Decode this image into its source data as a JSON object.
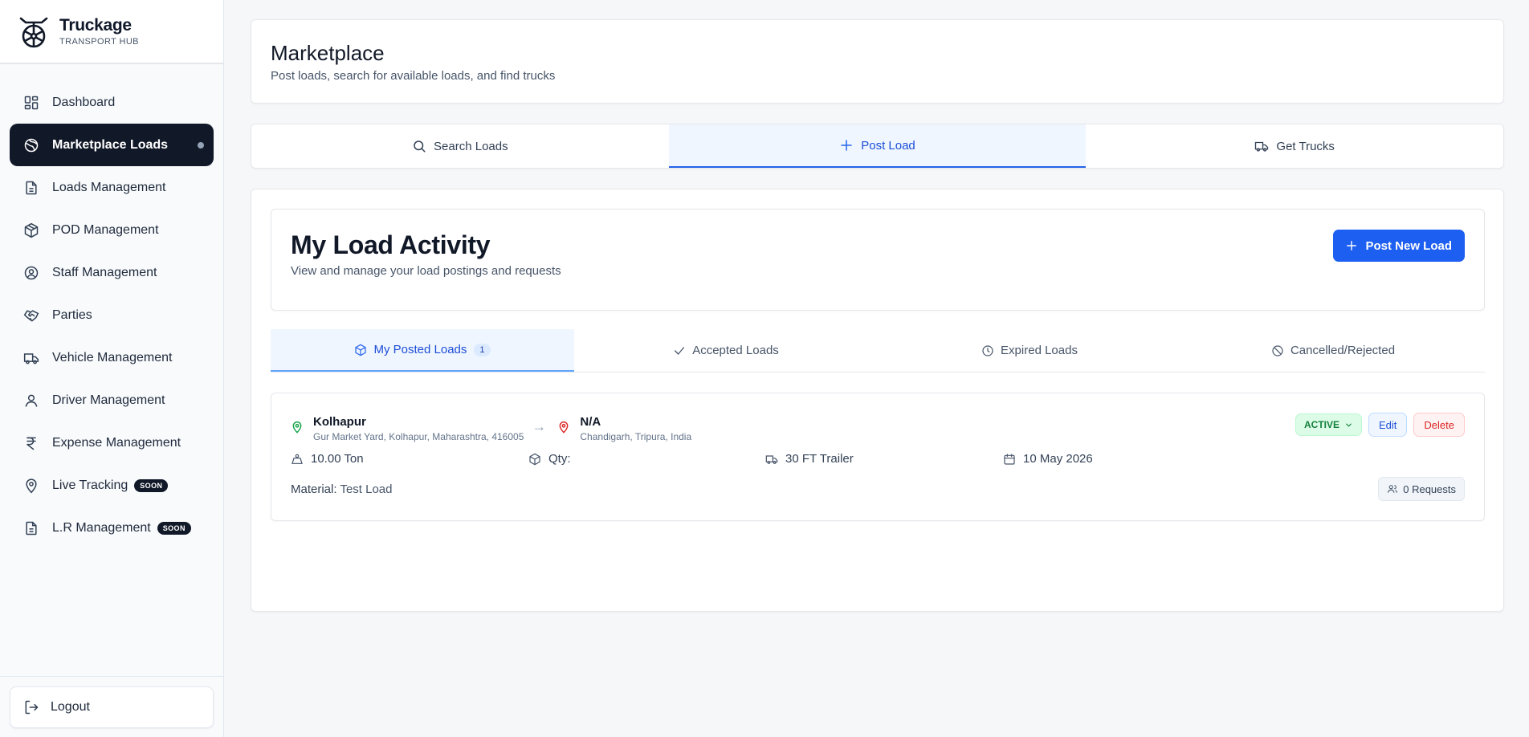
{
  "brand": {
    "name": "Truckage",
    "subtitle": "TRANSPORT HUB"
  },
  "sidebar": {
    "items": [
      {
        "label": "Dashboard",
        "icon": "dashboard-icon"
      },
      {
        "label": "Marketplace Loads",
        "icon": "globe-icon",
        "active": true
      },
      {
        "label": "Loads Management",
        "icon": "document-icon"
      },
      {
        "label": "POD Management",
        "icon": "package-icon"
      },
      {
        "label": "Staff Management",
        "icon": "user-circle-icon"
      },
      {
        "label": "Parties",
        "icon": "handshake-icon"
      },
      {
        "label": "Vehicle Management",
        "icon": "truck-icon"
      },
      {
        "label": "Driver Management",
        "icon": "user-icon"
      },
      {
        "label": "Expense Management",
        "icon": "rupee-icon"
      },
      {
        "label": "Live Tracking",
        "icon": "map-pin-icon",
        "badge": "SOON"
      },
      {
        "label": "L.R Management",
        "icon": "document-icon",
        "badge": "SOON"
      }
    ],
    "logout_label": "Logout"
  },
  "header": {
    "title": "Marketplace",
    "subtitle": "Post loads, search for available loads, and find trucks"
  },
  "main_tabs": [
    {
      "label": "Search Loads",
      "icon": "search-icon"
    },
    {
      "label": "Post Load",
      "icon": "plus-icon",
      "active": true
    },
    {
      "label": "Get Trucks",
      "icon": "truck-icon"
    }
  ],
  "activity": {
    "title": "My Load Activity",
    "subtitle": "View and manage your load postings and requests",
    "post_button_label": "Post New Load"
  },
  "sub_tabs": [
    {
      "label": "My Posted Loads",
      "icon": "package-icon",
      "count": "1",
      "active": true
    },
    {
      "label": "Accepted Loads",
      "icon": "check-icon"
    },
    {
      "label": "Expired Loads",
      "icon": "clock-icon"
    },
    {
      "label": "Cancelled/Rejected",
      "icon": "ban-icon"
    }
  ],
  "load": {
    "origin": {
      "city": "Kolhapur",
      "address": "Gur Market Yard, Kolhapur, Maharashtra, 416005"
    },
    "arrow": "→",
    "destination": {
      "city": "N/A",
      "address": "Chandigarh, Tripura, India"
    },
    "status": "ACTIVE",
    "edit_label": "Edit",
    "delete_label": "Delete",
    "weight": "10.00 Ton",
    "qty_label": "Qty:",
    "truck_type": "30 FT Trailer",
    "date": "10 May 2026",
    "material_label": "Material:",
    "material_value": "Test Load",
    "requests_label": "0 Requests"
  },
  "colors": {
    "primary": "#1d5ff0",
    "sidebar_active": "#111827",
    "status_active_bg": "#dcfce7",
    "status_active_text": "#15803d",
    "delete": "#dc2626",
    "origin_pin": "#16a34a",
    "destination_pin": "#dc2626"
  }
}
